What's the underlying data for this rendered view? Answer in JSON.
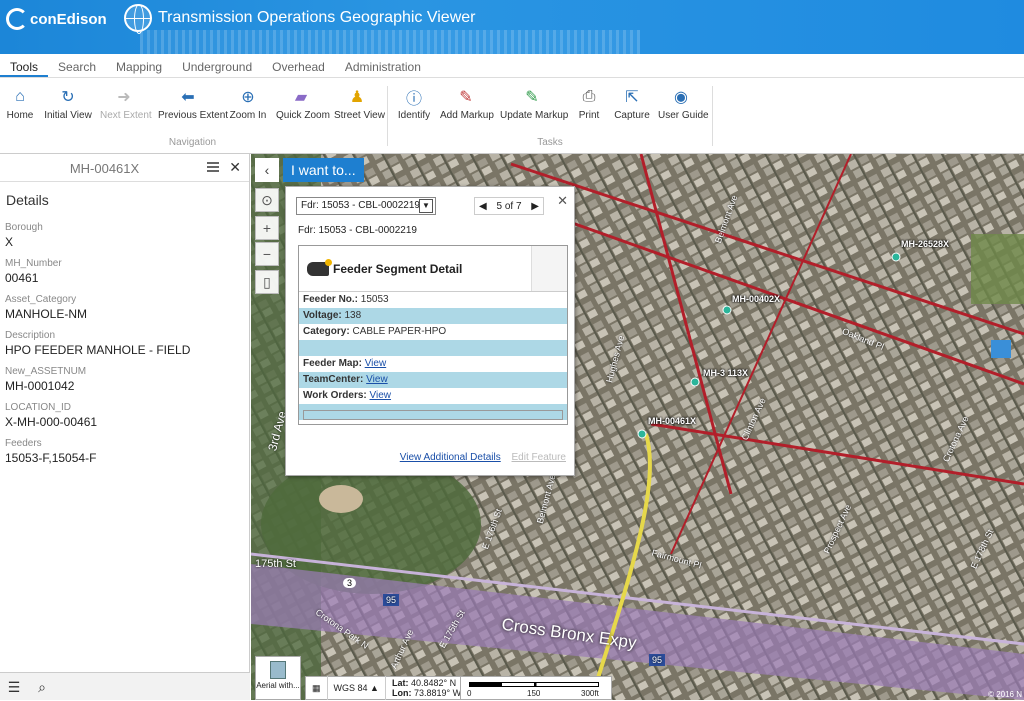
{
  "header": {
    "logo_text": "conEdison",
    "app_title": "Transmission Operations Geographic Viewer"
  },
  "tabs": [
    {
      "label": "Tools",
      "active": true
    },
    {
      "label": "Search"
    },
    {
      "label": "Mapping"
    },
    {
      "label": "Underground"
    },
    {
      "label": "Overhead"
    },
    {
      "label": "Administration"
    }
  ],
  "ribbon": {
    "navigation_label": "Navigation",
    "tasks_label": "Tasks",
    "buttons": {
      "home": "Home",
      "initial_view": "Initial View",
      "next_extent": "Next Extent",
      "previous_extent": "Previous Extent",
      "zoom_in": "Zoom In",
      "quick_zoom": "Quick Zoom",
      "street_view": "Street View",
      "identify": "Identify",
      "add_markup": "Add Markup",
      "update_markup": "Update Markup",
      "print": "Print",
      "capture": "Capture",
      "user_guide": "User Guide"
    }
  },
  "panel": {
    "title": "MH-00461X",
    "details_title": "Details",
    "fields": [
      {
        "label": "Borough",
        "value": "X"
      },
      {
        "label": "MH_Number",
        "value": "00461"
      },
      {
        "label": "Asset_Category",
        "value": "MANHOLE-NM"
      },
      {
        "label": "Description",
        "value": "HPO FEEDER MANHOLE - FIELD"
      },
      {
        "label": "New_ASSETNUM",
        "value": "MH-0001042"
      },
      {
        "label": "LOCATION_ID",
        "value": "X-MH-000-00461"
      },
      {
        "label": "Feeders",
        "value": "15053-F,15054-F"
      }
    ]
  },
  "map": {
    "i_want_to": "I want to...",
    "labels": {
      "mh1": "MH-26528X",
      "mh2": "MH-00402X",
      "mh3": "MH-3 113X",
      "mh4": "MH-00461X"
    },
    "streets": {
      "s175": "175th St",
      "cross_bronx": "Cross Bronx Expy",
      "belmont1": "Belmont Ave",
      "belmont2": "Belmont Ave",
      "oakland": "Oakland Pl",
      "hughes": "Hughes Ave",
      "clinton": "Clinton Ave",
      "crotona": "Crotona Ave",
      "prospect": "Prospect Ave",
      "e176": "E 176th St",
      "e178": "E 178th St",
      "fairmount": "Fairmount Pl",
      "e175": "E 175th St",
      "arthur": "Arthur Ave",
      "crotona_park": "Crotona Park N",
      "third": "3rd Ave",
      "rt3": "3",
      "i95a": "95",
      "i95b": "95"
    },
    "copyright": "© 2016 N"
  },
  "popup": {
    "select_value": "Fdr: 15053 - CBL-0002219",
    "pager": "5 of 7",
    "subtitle": "Fdr: 15053 - CBL-0002219",
    "card_title": "Feeder Segment Detail",
    "rows": [
      {
        "label": "Feeder No.:",
        "value": "15053"
      },
      {
        "label": "Voltage:",
        "value": "138"
      },
      {
        "label": "Category:",
        "value": "CABLE PAPER-HPO"
      }
    ],
    "links": [
      {
        "label": "Feeder Map:",
        "value": "View"
      },
      {
        "label": "TeamCenter:",
        "value": "View"
      },
      {
        "label": "Work Orders:",
        "value": "View"
      }
    ],
    "view_details": "View Additional Details",
    "edit_feature": "Edit Feature"
  },
  "status": {
    "basemap": "Aerial with...",
    "crs": "WGS 84",
    "lat_label": "Lat:",
    "lat": "40.8482° N",
    "lon_label": "Lon:",
    "lon": "73.8819° W",
    "scale": [
      "0",
      "150",
      "300ft"
    ]
  }
}
